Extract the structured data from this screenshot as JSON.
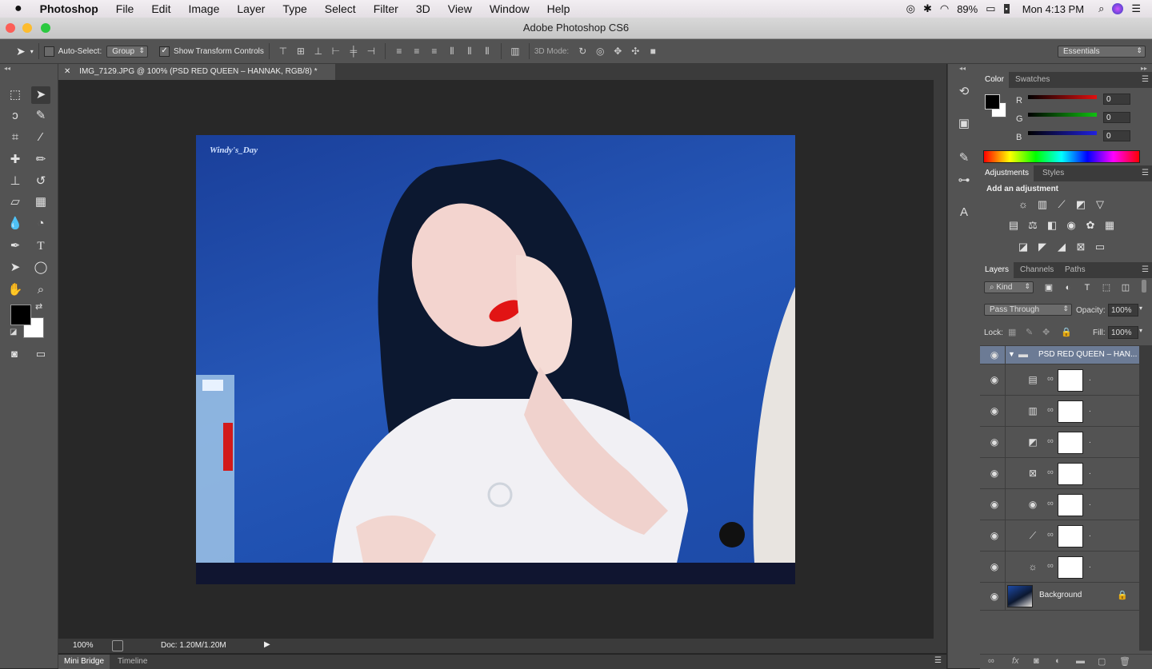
{
  "menubar": {
    "apple": "",
    "app_name": "Photoshop",
    "items": [
      "File",
      "Edit",
      "Image",
      "Layer",
      "Type",
      "Select",
      "Filter",
      "3D",
      "View",
      "Window",
      "Help"
    ],
    "battery": "89%",
    "clock": "Mon 4:13 PM"
  },
  "window": {
    "title": "Adobe Photoshop CS6"
  },
  "options": {
    "auto_select_label": "Auto-Select:",
    "auto_select_value": "Group",
    "show_transform_label": "Show Transform Controls",
    "mode_3d_label": "3D Mode:",
    "workspace": "Essentials"
  },
  "document": {
    "tab_title": "IMG_7129.JPG @ 100% (PSD RED QUEEN  – HANNAK, RGB/8) *",
    "watermark": "Windy's_Day"
  },
  "status": {
    "zoom": "100%",
    "doc_info": "Doc: 1.20M/1.20M"
  },
  "bottom_tabs": [
    "Mini Bridge",
    "Timeline"
  ],
  "color_panel": {
    "tabs": [
      "Color",
      "Swatches"
    ],
    "channels": [
      {
        "label": "R",
        "value": "0",
        "color": "#e01010"
      },
      {
        "label": "G",
        "value": "0",
        "color": "#10c010"
      },
      {
        "label": "B",
        "value": "0",
        "color": "#2020e0"
      }
    ]
  },
  "adjustments_panel": {
    "tabs": [
      "Adjustments",
      "Styles"
    ],
    "heading": "Add an adjustment"
  },
  "layers_panel": {
    "tabs": [
      "Layers",
      "Channels",
      "Paths"
    ],
    "filter_kind": "Kind",
    "blend_mode": "Pass Through",
    "opacity_label": "Opacity:",
    "opacity": "100%",
    "lock_label": "Lock:",
    "fill_label": "Fill:",
    "fill": "100%",
    "group_name": "PSD RED QUEEN  – HAN...",
    "adjustment_layers": [
      {
        "icon": "channel-mixer-icon",
        "name": "."
      },
      {
        "icon": "levels-icon",
        "name": "."
      },
      {
        "icon": "exposure-icon",
        "name": "."
      },
      {
        "icon": "selective-color-icon",
        "name": "."
      },
      {
        "icon": "photo-filter-icon",
        "name": "."
      },
      {
        "icon": "curves-icon",
        "name": "."
      },
      {
        "icon": "brightness-icon",
        "name": "."
      }
    ],
    "background_name": "Background"
  }
}
